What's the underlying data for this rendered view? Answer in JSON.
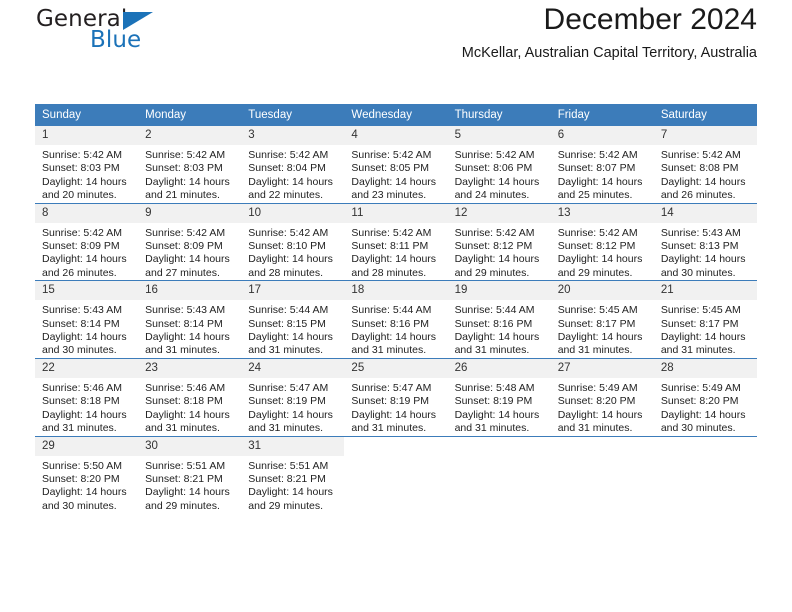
{
  "branding": {
    "name_top": "General",
    "name_bottom": "Blue",
    "triangle_color": "#1b72b8",
    "text_color": "#231f20"
  },
  "header": {
    "title": "December 2024",
    "subtitle": "McKellar, Australian Capital Territory, Australia"
  },
  "colors": {
    "header_row_bg": "#3c7cba",
    "header_row_text": "#ffffff",
    "daynum_bg": "#f1f1f1",
    "cell_bg": "#ffffff",
    "grid_line": "#3c7cba",
    "body_text": "#222222"
  },
  "calendar": {
    "weekday_headers": [
      "Sunday",
      "Monday",
      "Tuesday",
      "Wednesday",
      "Thursday",
      "Friday",
      "Saturday"
    ],
    "weeks": [
      [
        {
          "day": "1",
          "sunrise": "Sunrise: 5:42 AM",
          "sunset": "Sunset: 8:03 PM",
          "daylight_line1": "Daylight: 14 hours",
          "daylight_line2": "and 20 minutes."
        },
        {
          "day": "2",
          "sunrise": "Sunrise: 5:42 AM",
          "sunset": "Sunset: 8:03 PM",
          "daylight_line1": "Daylight: 14 hours",
          "daylight_line2": "and 21 minutes."
        },
        {
          "day": "3",
          "sunrise": "Sunrise: 5:42 AM",
          "sunset": "Sunset: 8:04 PM",
          "daylight_line1": "Daylight: 14 hours",
          "daylight_line2": "and 22 minutes."
        },
        {
          "day": "4",
          "sunrise": "Sunrise: 5:42 AM",
          "sunset": "Sunset: 8:05 PM",
          "daylight_line1": "Daylight: 14 hours",
          "daylight_line2": "and 23 minutes."
        },
        {
          "day": "5",
          "sunrise": "Sunrise: 5:42 AM",
          "sunset": "Sunset: 8:06 PM",
          "daylight_line1": "Daylight: 14 hours",
          "daylight_line2": "and 24 minutes."
        },
        {
          "day": "6",
          "sunrise": "Sunrise: 5:42 AM",
          "sunset": "Sunset: 8:07 PM",
          "daylight_line1": "Daylight: 14 hours",
          "daylight_line2": "and 25 minutes."
        },
        {
          "day": "7",
          "sunrise": "Sunrise: 5:42 AM",
          "sunset": "Sunset: 8:08 PM",
          "daylight_line1": "Daylight: 14 hours",
          "daylight_line2": "and 26 minutes."
        }
      ],
      [
        {
          "day": "8",
          "sunrise": "Sunrise: 5:42 AM",
          "sunset": "Sunset: 8:09 PM",
          "daylight_line1": "Daylight: 14 hours",
          "daylight_line2": "and 26 minutes."
        },
        {
          "day": "9",
          "sunrise": "Sunrise: 5:42 AM",
          "sunset": "Sunset: 8:09 PM",
          "daylight_line1": "Daylight: 14 hours",
          "daylight_line2": "and 27 minutes."
        },
        {
          "day": "10",
          "sunrise": "Sunrise: 5:42 AM",
          "sunset": "Sunset: 8:10 PM",
          "daylight_line1": "Daylight: 14 hours",
          "daylight_line2": "and 28 minutes."
        },
        {
          "day": "11",
          "sunrise": "Sunrise: 5:42 AM",
          "sunset": "Sunset: 8:11 PM",
          "daylight_line1": "Daylight: 14 hours",
          "daylight_line2": "and 28 minutes."
        },
        {
          "day": "12",
          "sunrise": "Sunrise: 5:42 AM",
          "sunset": "Sunset: 8:12 PM",
          "daylight_line1": "Daylight: 14 hours",
          "daylight_line2": "and 29 minutes."
        },
        {
          "day": "13",
          "sunrise": "Sunrise: 5:42 AM",
          "sunset": "Sunset: 8:12 PM",
          "daylight_line1": "Daylight: 14 hours",
          "daylight_line2": "and 29 minutes."
        },
        {
          "day": "14",
          "sunrise": "Sunrise: 5:43 AM",
          "sunset": "Sunset: 8:13 PM",
          "daylight_line1": "Daylight: 14 hours",
          "daylight_line2": "and 30 minutes."
        }
      ],
      [
        {
          "day": "15",
          "sunrise": "Sunrise: 5:43 AM",
          "sunset": "Sunset: 8:14 PM",
          "daylight_line1": "Daylight: 14 hours",
          "daylight_line2": "and 30 minutes."
        },
        {
          "day": "16",
          "sunrise": "Sunrise: 5:43 AM",
          "sunset": "Sunset: 8:14 PM",
          "daylight_line1": "Daylight: 14 hours",
          "daylight_line2": "and 31 minutes."
        },
        {
          "day": "17",
          "sunrise": "Sunrise: 5:44 AM",
          "sunset": "Sunset: 8:15 PM",
          "daylight_line1": "Daylight: 14 hours",
          "daylight_line2": "and 31 minutes."
        },
        {
          "day": "18",
          "sunrise": "Sunrise: 5:44 AM",
          "sunset": "Sunset: 8:16 PM",
          "daylight_line1": "Daylight: 14 hours",
          "daylight_line2": "and 31 minutes."
        },
        {
          "day": "19",
          "sunrise": "Sunrise: 5:44 AM",
          "sunset": "Sunset: 8:16 PM",
          "daylight_line1": "Daylight: 14 hours",
          "daylight_line2": "and 31 minutes."
        },
        {
          "day": "20",
          "sunrise": "Sunrise: 5:45 AM",
          "sunset": "Sunset: 8:17 PM",
          "daylight_line1": "Daylight: 14 hours",
          "daylight_line2": "and 31 minutes."
        },
        {
          "day": "21",
          "sunrise": "Sunrise: 5:45 AM",
          "sunset": "Sunset: 8:17 PM",
          "daylight_line1": "Daylight: 14 hours",
          "daylight_line2": "and 31 minutes."
        }
      ],
      [
        {
          "day": "22",
          "sunrise": "Sunrise: 5:46 AM",
          "sunset": "Sunset: 8:18 PM",
          "daylight_line1": "Daylight: 14 hours",
          "daylight_line2": "and 31 minutes."
        },
        {
          "day": "23",
          "sunrise": "Sunrise: 5:46 AM",
          "sunset": "Sunset: 8:18 PM",
          "daylight_line1": "Daylight: 14 hours",
          "daylight_line2": "and 31 minutes."
        },
        {
          "day": "24",
          "sunrise": "Sunrise: 5:47 AM",
          "sunset": "Sunset: 8:19 PM",
          "daylight_line1": "Daylight: 14 hours",
          "daylight_line2": "and 31 minutes."
        },
        {
          "day": "25",
          "sunrise": "Sunrise: 5:47 AM",
          "sunset": "Sunset: 8:19 PM",
          "daylight_line1": "Daylight: 14 hours",
          "daylight_line2": "and 31 minutes."
        },
        {
          "day": "26",
          "sunrise": "Sunrise: 5:48 AM",
          "sunset": "Sunset: 8:19 PM",
          "daylight_line1": "Daylight: 14 hours",
          "daylight_line2": "and 31 minutes."
        },
        {
          "day": "27",
          "sunrise": "Sunrise: 5:49 AM",
          "sunset": "Sunset: 8:20 PM",
          "daylight_line1": "Daylight: 14 hours",
          "daylight_line2": "and 31 minutes."
        },
        {
          "day": "28",
          "sunrise": "Sunrise: 5:49 AM",
          "sunset": "Sunset: 8:20 PM",
          "daylight_line1": "Daylight: 14 hours",
          "daylight_line2": "and 30 minutes."
        }
      ],
      [
        {
          "day": "29",
          "sunrise": "Sunrise: 5:50 AM",
          "sunset": "Sunset: 8:20 PM",
          "daylight_line1": "Daylight: 14 hours",
          "daylight_line2": "and 30 minutes."
        },
        {
          "day": "30",
          "sunrise": "Sunrise: 5:51 AM",
          "sunset": "Sunset: 8:21 PM",
          "daylight_line1": "Daylight: 14 hours",
          "daylight_line2": "and 29 minutes."
        },
        {
          "day": "31",
          "sunrise": "Sunrise: 5:51 AM",
          "sunset": "Sunset: 8:21 PM",
          "daylight_line1": "Daylight: 14 hours",
          "daylight_line2": "and 29 minutes."
        },
        {
          "day": "",
          "sunrise": "",
          "sunset": "",
          "daylight_line1": "",
          "daylight_line2": ""
        },
        {
          "day": "",
          "sunrise": "",
          "sunset": "",
          "daylight_line1": "",
          "daylight_line2": ""
        },
        {
          "day": "",
          "sunrise": "",
          "sunset": "",
          "daylight_line1": "",
          "daylight_line2": ""
        },
        {
          "day": "",
          "sunrise": "",
          "sunset": "",
          "daylight_line1": "",
          "daylight_line2": ""
        }
      ]
    ]
  }
}
